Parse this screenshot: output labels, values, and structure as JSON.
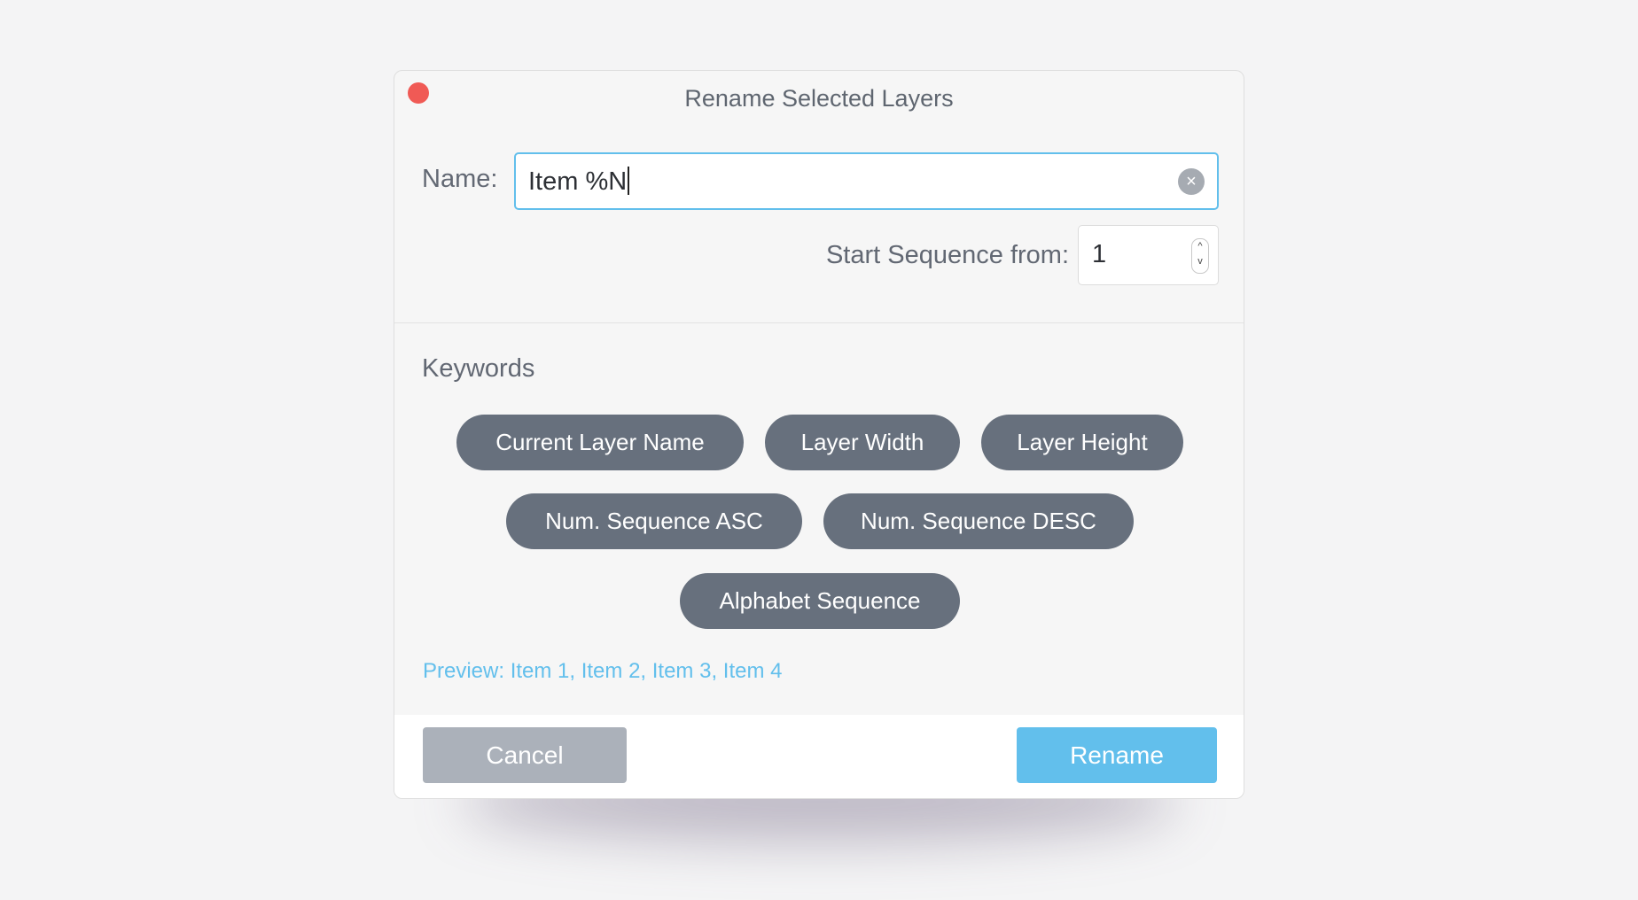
{
  "dialog": {
    "title": "Rename Selected Layers",
    "name_label": "Name:",
    "name_value": "Item %N",
    "clear_icon": "×",
    "start_label": "Start Sequence from:",
    "start_value": "1",
    "stepper_up": "^",
    "stepper_down": "v",
    "keywords_label": "Keywords",
    "keywords": [
      "Current Layer Name",
      "Layer Width",
      "Layer Height",
      "Num. Sequence ASC",
      "Num. Sequence DESC",
      "Alphabet Sequence"
    ],
    "preview": "Preview: Item 1, Item 2, Item 3, Item 4",
    "cancel_label": "Cancel",
    "rename_label": "Rename"
  },
  "colors": {
    "accent": "#62bfec",
    "pill": "#67707d",
    "cancel": "#abb1ba",
    "close": "#f05a55"
  }
}
